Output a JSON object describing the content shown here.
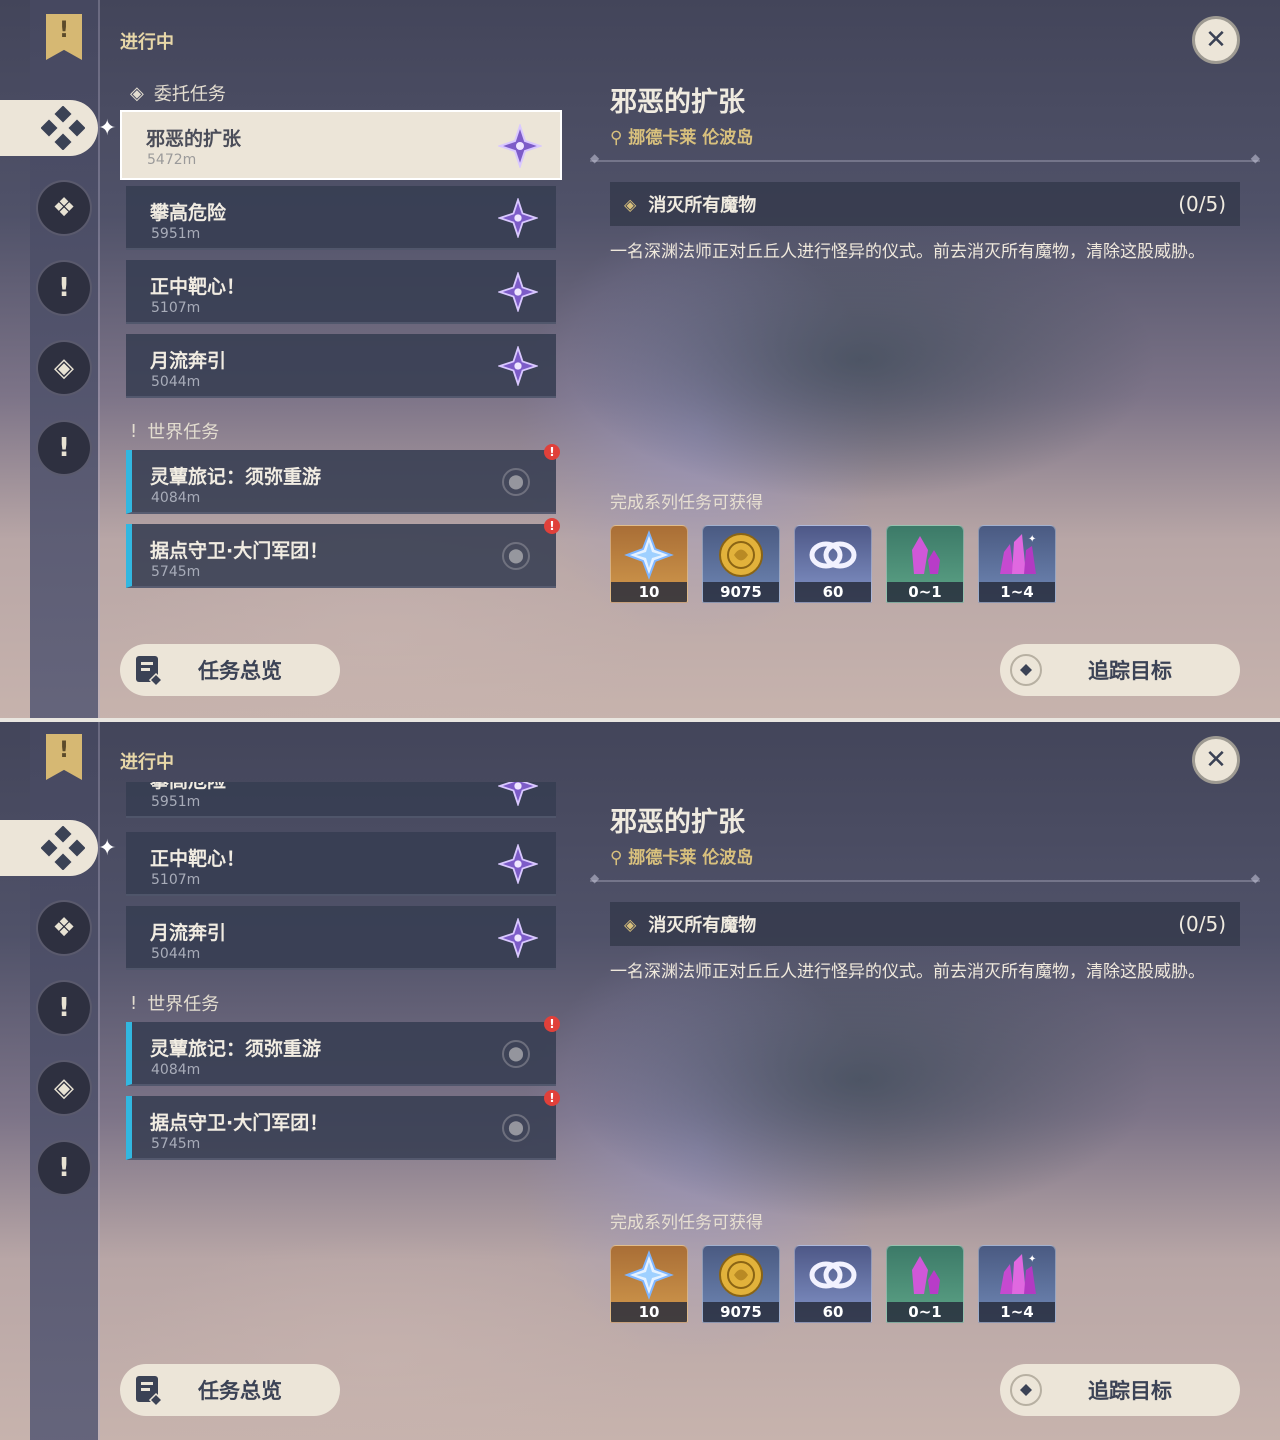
{
  "header": {
    "in_progress": "进行中"
  },
  "sections": {
    "commission": "委托任务",
    "world": "世界任务"
  },
  "quests": [
    {
      "name": "邪恶的扩张",
      "distance": "5472m"
    },
    {
      "name": "攀高危险",
      "distance": "5951m"
    },
    {
      "name": "正中靶心！",
      "distance": "5107m"
    },
    {
      "name": "月流奔引",
      "distance": "5044m"
    }
  ],
  "world_quests": [
    {
      "name": "灵蕈旅记：须弥重游",
      "distance": "4084m"
    },
    {
      "name": "据点守卫·大门军团！",
      "distance": "5745m"
    }
  ],
  "alert_glyph": "!",
  "detail": {
    "title": "邪恶的扩张",
    "location": "挪德卡莱 伦波岛",
    "objective": "消灭所有魔物",
    "progress": "(0/5)",
    "description": "一名深渊法师正对丘丘人进行怪异的仪式。前去消灭所有魔物，清除这股威胁。",
    "reward_title": "完成系列任务可获得"
  },
  "rewards": [
    {
      "icon": "primogem-icon",
      "count": "10"
    },
    {
      "icon": "mora-icon",
      "count": "9075"
    },
    {
      "icon": "companionship-exp-icon",
      "count": "60"
    },
    {
      "icon": "crystal-small-icon",
      "count": "0~1"
    },
    {
      "icon": "crystal-cluster-icon",
      "count": "1~4"
    }
  ],
  "buttons": {
    "overview": "任务总览",
    "track": "追踪目标",
    "close": "✕"
  },
  "colors": {
    "accent_cream": "#ece5d8",
    "world_quest_bar": "#32b7e0",
    "alert_red": "#e0403a",
    "location_gold": "#d8c07d"
  }
}
